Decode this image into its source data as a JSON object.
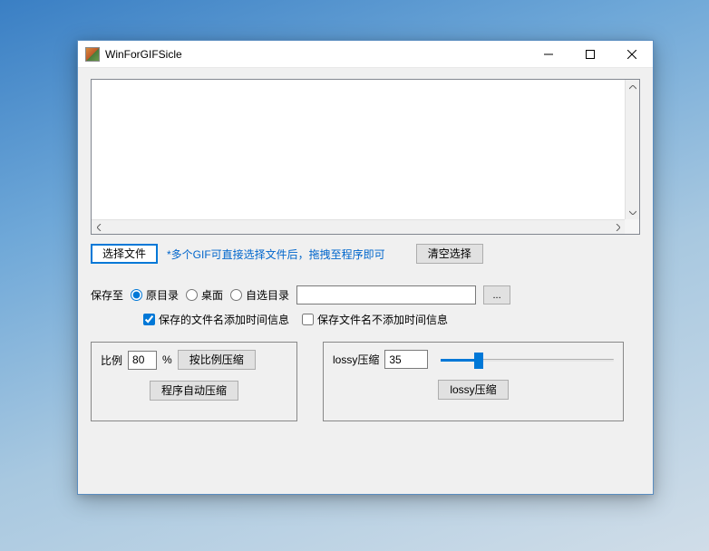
{
  "window": {
    "title": "WinForGIFSicle"
  },
  "toolbar": {
    "select_file": "选择文件",
    "hint": "*多个GIF可直接选择文件后，拖拽至程序即可",
    "clear": "清空选择"
  },
  "save": {
    "label": "保存至",
    "options": {
      "original": "原目录",
      "desktop": "桌面",
      "custom": "自选目录"
    },
    "selected": "original",
    "custom_path": "",
    "browse": "..."
  },
  "filename": {
    "add_time_checked": true,
    "add_time_label": "保存的文件名添加时间信息",
    "no_time_checked": false,
    "no_time_label": "保存文件名不添加时间信息"
  },
  "ratio_panel": {
    "label": "比例",
    "value": "80",
    "percent": "%",
    "btn_ratio_compress": "按比例压缩",
    "btn_auto_compress": "程序自动压缩"
  },
  "lossy_panel": {
    "label": "lossy压缩",
    "value": "35",
    "btn_compress": "lossy压缩"
  }
}
